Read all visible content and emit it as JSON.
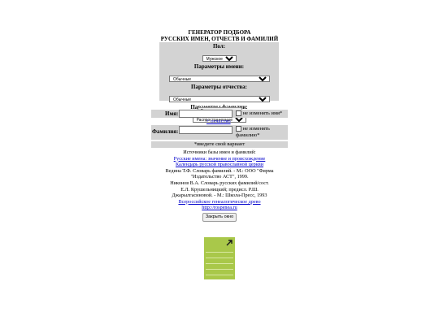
{
  "title": {
    "line1": "ГЕНЕРАТОР ПОДБОРА",
    "line2": "РУССКИХ ИМЕН, ОТЧЕСТВ И ФАМИЛИЙ"
  },
  "params": {
    "gender_label": "Пол:",
    "gender_value": "Мужское имя",
    "name_label": "Параметры имени:",
    "name_value": "Обычные",
    "patronymic_label": "Параметры отчества:",
    "patronymic_value": "Обычные",
    "surname_label": "Параметры фамилии:",
    "surname_value": "Распространенные"
  },
  "generate_button": "Генерировать имя",
  "fields": {
    "name_label": "Имя:",
    "name_keep": "не изменять имя*",
    "patronymic_link": "+ отчество",
    "surname_label": "Фамилия:",
    "surname_keep": "не изменять фамилию*"
  },
  "note": "*введите свой вариант",
  "sources": {
    "heading": "Источники базы имен и фамилий:",
    "link1": "Русские имена: значение и происхождение",
    "link2": "Календарь русской православной церкви",
    "ref1_line1": "Ведина Т.Ф. Словарь фамилий. - М.: ООО \"Фирма",
    "ref1_line2": "\"Издательство АСТ\", 1999.",
    "ref2_line1": "Никонов В.А. Словарь русских фамилий/сост.",
    "ref2_line2": "Е.Л. Крушельницкий; предисл. Р.Ш.",
    "ref2_line3": "Джарылгасиновой. - М.: Школа-Пресс, 1993",
    "link3": "Всероссийское генеалогическое древо",
    "link4": "http://rospenea.ru"
  },
  "close_button": "Закрыть окно",
  "colors": {
    "panel": "#d3d3d3",
    "link": "#0000cc",
    "logo": "#a9c84a"
  }
}
